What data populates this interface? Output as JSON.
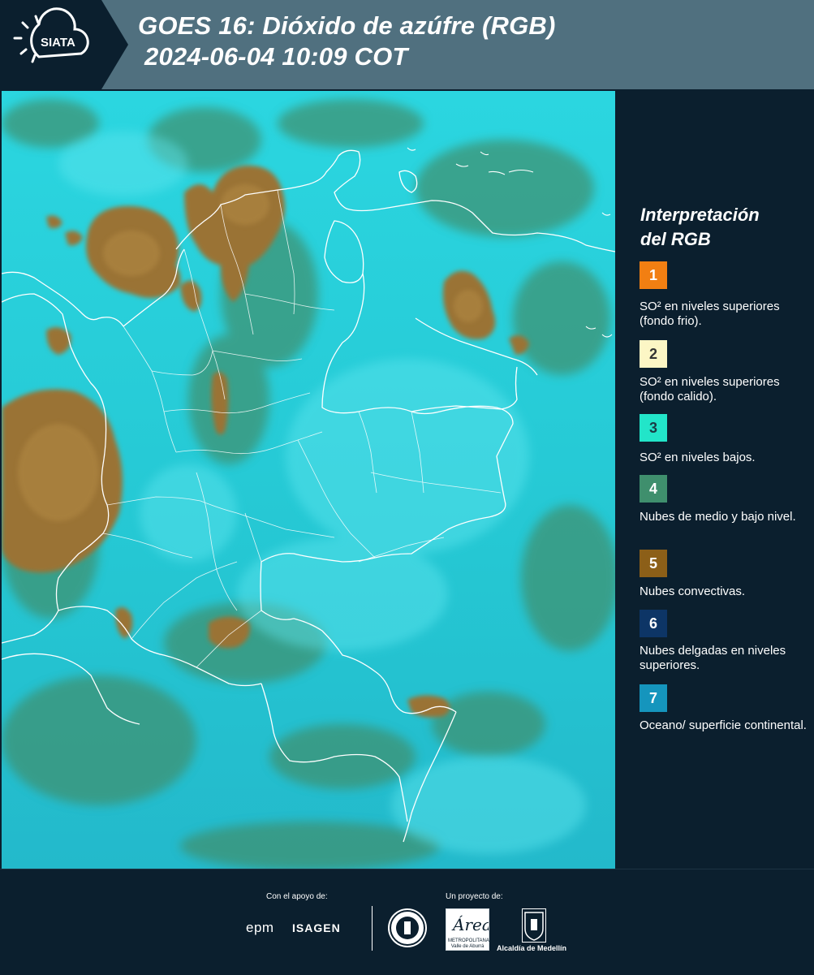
{
  "header": {
    "logo_text": "SIATA",
    "title_line1": "GOES 16: Dióxido de azúfre (RGB)",
    "title_line2": " 2024-06-04 10:09 COT"
  },
  "legend": {
    "title_line1": "Interpretación",
    "title_line2": "del RGB",
    "items": [
      {
        "number": "1",
        "color": "#f27f12",
        "text_color": "#ffffff",
        "label": "SO² en niveles superiores (fondo frio)."
      },
      {
        "number": "2",
        "color": "#fcf6c5",
        "text_color": "#333333",
        "label": "SO² en niveles superiores (fondo calido)."
      },
      {
        "number": "3",
        "color": "#22e5c9",
        "text_color": "#1b3a44",
        "label": "SO² en niveles bajos."
      },
      {
        "number": "4",
        "color": "#3f8f6d",
        "text_color": "#ffffff",
        "label": "Nubes de medio y bajo nivel."
      },
      {
        "number": "5",
        "color": "#8c5f18",
        "text_color": "#ffffff",
        "label": "Nubes convectivas."
      },
      {
        "number": "6",
        "color": "#0d3566",
        "text_color": "#ffffff",
        "label": "Nubes delgadas en niveles superiores."
      },
      {
        "number": "7",
        "color": "#1595bd",
        "text_color": "#ffffff",
        "label": "Oceano/ superficie continental."
      }
    ]
  },
  "map": {
    "colors": {
      "background": "#25c7d3",
      "convective": "#9a7336",
      "mid_low": "#3f8f6d",
      "borders": "#ffffff"
    }
  },
  "footer": {
    "support_label": "Con el apoyo de:",
    "project_label": "Un proyecto de:",
    "epm": "epm",
    "isagen": "ISAGEN",
    "area_text": "METROPOLITANA Valle de Aburrá",
    "medellin": "Alcaldía de Medellín"
  }
}
